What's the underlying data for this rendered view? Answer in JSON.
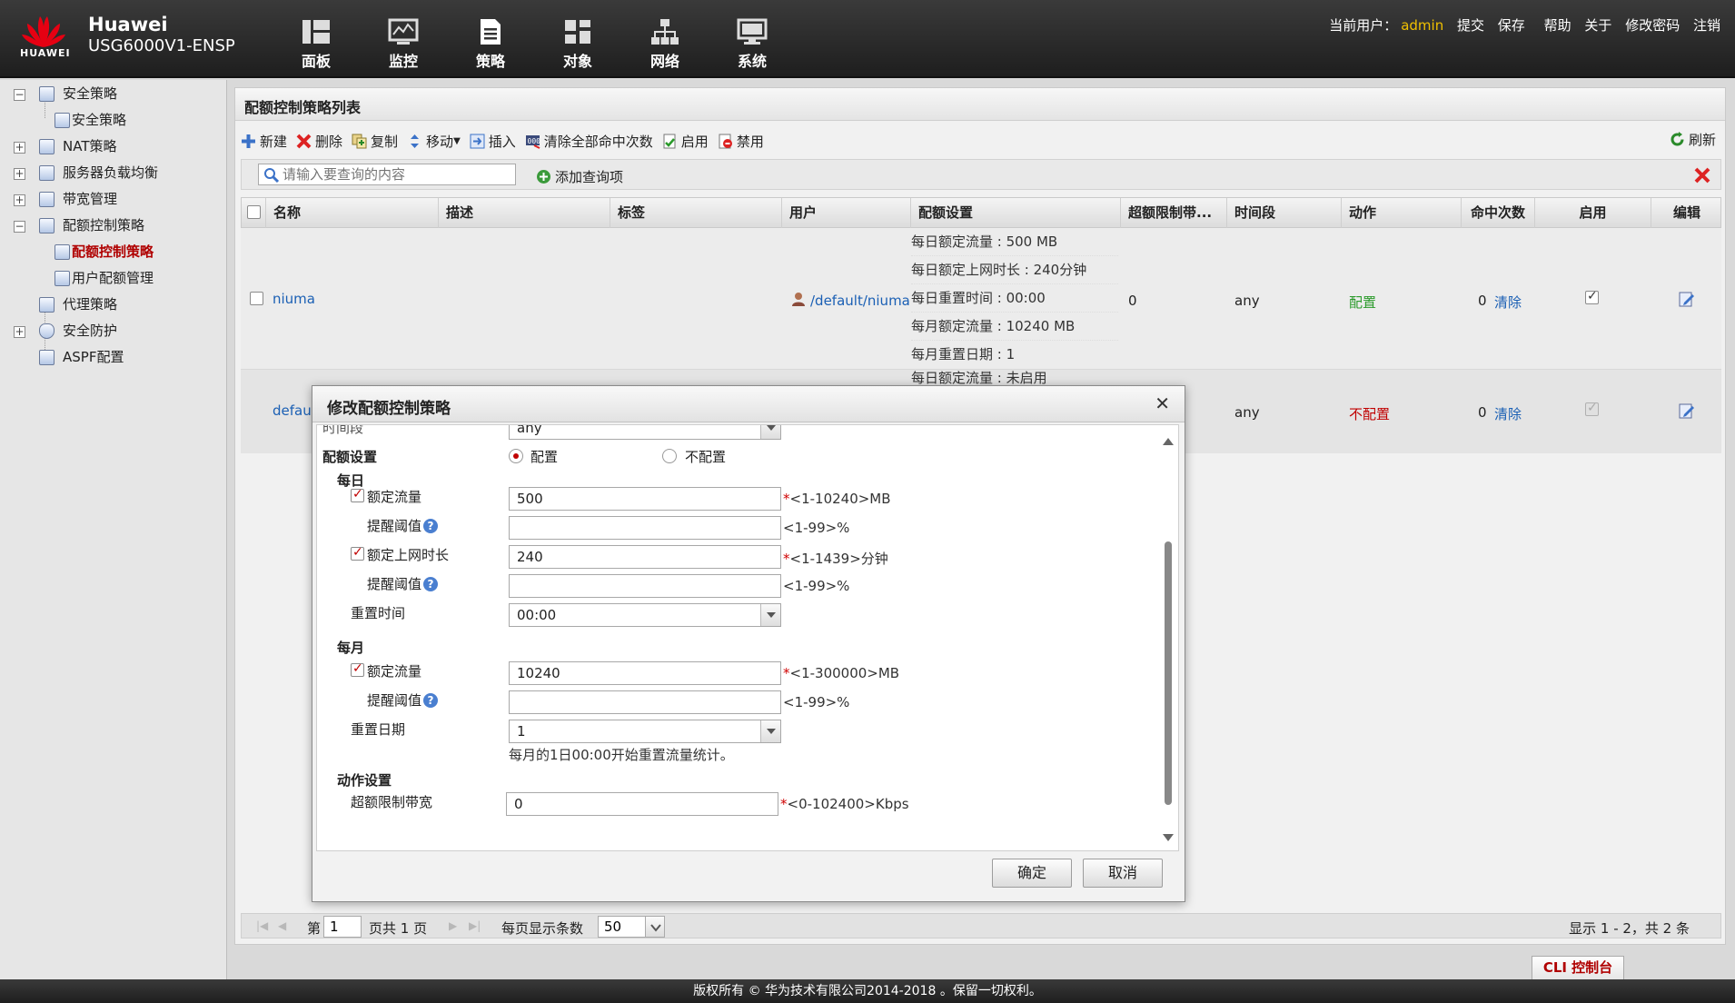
{
  "header": {
    "brand_logo_text": "HUAWEI",
    "brand_name": "Huawei",
    "device_model": "USG6000V1-ENSP",
    "nav": [
      {
        "label": "面板",
        "icon": "dashboard-icon"
      },
      {
        "label": "监控",
        "icon": "monitor-icon"
      },
      {
        "label": "策略",
        "icon": "policy-icon"
      },
      {
        "label": "对象",
        "icon": "object-icon"
      },
      {
        "label": "网络",
        "icon": "network-icon"
      },
      {
        "label": "系统",
        "icon": "system-icon"
      }
    ],
    "current_user_label": "当前用户：",
    "current_user": "admin",
    "commit": "提交",
    "save": "保存",
    "help": "帮助",
    "about": "关于",
    "change_password": "修改密码",
    "logout": "注销"
  },
  "sidebar": {
    "items": [
      {
        "label": "安全策略",
        "toggle": "−"
      },
      {
        "label": "安全策略"
      },
      {
        "label": "NAT策略",
        "toggle": "+"
      },
      {
        "label": "服务器负载均衡",
        "toggle": "+"
      },
      {
        "label": "带宽管理",
        "toggle": "+"
      },
      {
        "label": "配额控制策略",
        "toggle": "−"
      },
      {
        "label": "配额控制策略",
        "active": true
      },
      {
        "label": "用户配额管理"
      },
      {
        "label": "代理策略"
      },
      {
        "label": "安全防护",
        "toggle": "+"
      },
      {
        "label": "ASPF配置"
      }
    ]
  },
  "panel": {
    "title": "配额控制策略列表",
    "toolbar": {
      "new": "新建",
      "delete": "删除",
      "copy": "复制",
      "move": "移动",
      "insert": "插入",
      "clear_hits": "清除全部命中次数",
      "enable": "启用",
      "disable": "禁用",
      "refresh": "刷新"
    },
    "search_placeholder": "请输入要查询的内容",
    "add_query": "添加查询项",
    "columns": {
      "name": "名称",
      "desc": "描述",
      "tag": "标签",
      "user": "用户",
      "quota": "配额设置",
      "over_limit": "超额限制带...",
      "time": "时间段",
      "action": "动作",
      "hits": "命中次数",
      "enable": "启用",
      "edit": "编辑"
    },
    "rows": [
      {
        "name": "niuma",
        "user": "/default/niuma",
        "quota": [
          "每日额定流量 : 500 MB",
          "每日额定上网时长 : 240分钟",
          "每日重置时间 : 00:00",
          "每月额定流量 : 10240 MB",
          "每月重置日期 : 1"
        ],
        "over_limit": "0",
        "time": "any",
        "action": "配置",
        "hits": "0",
        "clear": "清除"
      },
      {
        "name": "default",
        "quota_top": "每日额定流量 : 未启用",
        "time": "any",
        "action": "不配置",
        "hits": "0",
        "clear": "清除"
      }
    ],
    "pager": {
      "page_prefix": "第",
      "page_value": "1",
      "page_suffix": "页共 1 页",
      "per_page_label": "每页显示条数",
      "per_page_value": "50",
      "summary": "显示 1 - 2，共 2 条"
    }
  },
  "cli": "CLI 控制台",
  "footer": "版权所有 © 华为技术有限公司2014-2018 。保留一切权利。",
  "modal": {
    "title": "修改配额控制策略",
    "time_label_cut": "时间段",
    "time_value": "any",
    "quota_label": "配额设置",
    "radio_on": "配置",
    "radio_off": "不配置",
    "daily": "每日",
    "daily_flow_label": "额定流量",
    "daily_flow_value": "500",
    "daily_flow_hint": "<1-10240>MB",
    "remind_label": "提醒阈值",
    "remind_hint": "<1-99>%",
    "online_label": "额定上网时长",
    "online_value": "240",
    "online_hint": "<1-1439>分钟",
    "reset_time_label": "重置时间",
    "reset_time_value": "00:00",
    "monthly": "每月",
    "monthly_flow_label": "额定流量",
    "monthly_flow_value": "10240",
    "monthly_flow_hint": "<1-300000>MB",
    "reset_date_label": "重置日期",
    "reset_date_value": "1",
    "reset_date_note": "每月的1日00:00开始重置流量统计。",
    "action_label": "动作设置",
    "over_bw_label": "超额限制带宽",
    "over_bw_value": "0",
    "over_bw_hint": "<0-102400>Kbps",
    "required_mark": "*",
    "help_mark": "?",
    "ok": "确定",
    "cancel": "取消"
  }
}
